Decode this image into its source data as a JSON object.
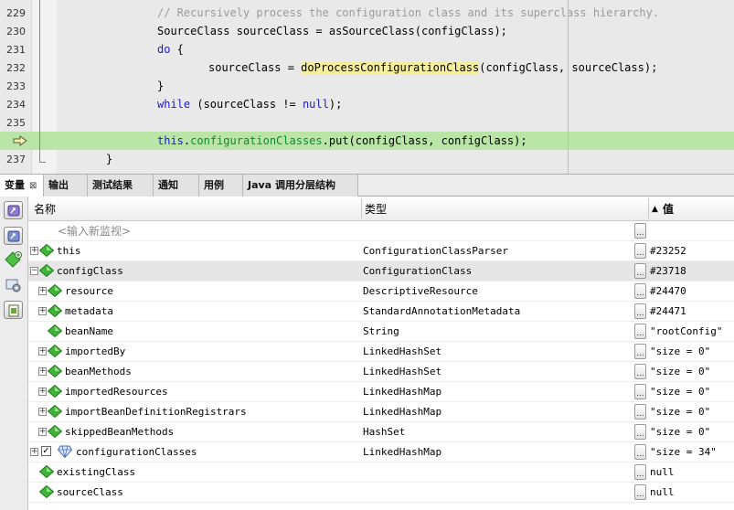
{
  "editor": {
    "lines": [
      {
        "num": "229",
        "segments": [
          {
            "t": "// Recursively process the configuration class and its superclass hierarchy.",
            "c": "cm"
          }
        ]
      },
      {
        "num": "230",
        "segments": [
          {
            "t": "SourceClass sourceClass = asSourceClass(configClass);",
            "c": ""
          }
        ]
      },
      {
        "num": "231",
        "segments": [
          {
            "t": "do",
            "c": "kw"
          },
          {
            "t": " {",
            "c": ""
          }
        ]
      },
      {
        "num": "232",
        "segments": [
          {
            "t": "sourceClass = ",
            "c": ""
          },
          {
            "t": "doProcessConfigurationClass",
            "c": "hl"
          },
          {
            "t": "(configClass, sourceClass);",
            "c": ""
          }
        ]
      },
      {
        "num": "233",
        "segments": [
          {
            "t": "}",
            "c": ""
          }
        ]
      },
      {
        "num": "234",
        "segments": [
          {
            "t": "while",
            "c": "kw"
          },
          {
            "t": " (sourceClass != ",
            "c": ""
          },
          {
            "t": "null",
            "c": "kw"
          },
          {
            "t": ");",
            "c": ""
          }
        ]
      },
      {
        "num": "235",
        "segments": []
      },
      {
        "num": "236",
        "current": true,
        "segments": [
          {
            "t": "this",
            "c": "kw"
          },
          {
            "t": ".",
            "c": ""
          },
          {
            "t": "configurationClasses",
            "c": "fld"
          },
          {
            "t": ".put(configClass, configClass);",
            "c": ""
          }
        ]
      },
      {
        "num": "237",
        "segments": [
          {
            "t": "}",
            "c": ""
          }
        ]
      }
    ]
  },
  "tabs": [
    {
      "label": "变量",
      "close": "⊠",
      "active": true
    },
    {
      "label": "输出"
    },
    {
      "label": "测试结果"
    },
    {
      "label": "通知"
    },
    {
      "label": "用例"
    },
    {
      "label": "Java 调用分层结构"
    }
  ],
  "toolbar_icons": [
    "watch-icon",
    "watch-add-icon",
    "new-watch-icon",
    "settings-icon",
    "clipboard-icon"
  ],
  "vars": {
    "columns": {
      "name": "名称",
      "type": "类型",
      "value": "值",
      "sort_glyph": "▲"
    },
    "value_button": "...",
    "placeholder": "<输入新监视>",
    "rows": [
      {
        "name": "this",
        "type": "ConfigurationClassParser",
        "value": "#23252",
        "expander": "+",
        "icon": "field-icon"
      },
      {
        "name": "configClass",
        "type": "ConfigurationClass",
        "value": "#23718",
        "expander": "−",
        "icon": "field-icon",
        "selected": true
      },
      {
        "name": "resource",
        "type": "DescriptiveResource",
        "value": "#24470",
        "expander": "+",
        "icon": "field-icon",
        "depth": 1
      },
      {
        "name": "metadata",
        "type": "StandardAnnotationMetadata",
        "value": "#24471",
        "expander": "+",
        "icon": "field-icon",
        "depth": 1
      },
      {
        "name": "beanName",
        "type": "String",
        "value": "\"rootConfig\"",
        "icon": "field-icon",
        "depth": 1
      },
      {
        "name": "importedBy",
        "type": "LinkedHashSet",
        "value": "\"size = 0\"",
        "expander": "+",
        "icon": "field-icon",
        "depth": 1
      },
      {
        "name": "beanMethods",
        "type": "LinkedHashSet",
        "value": "\"size = 0\"",
        "expander": "+",
        "icon": "field-icon",
        "depth": 1
      },
      {
        "name": "importedResources",
        "type": "LinkedHashMap",
        "value": "\"size = 0\"",
        "expander": "+",
        "icon": "field-icon",
        "depth": 1
      },
      {
        "name": "importBeanDefinitionRegistrars",
        "type": "LinkedHashMap",
        "value": "\"size = 0\"",
        "expander": "+",
        "icon": "field-icon",
        "depth": 1
      },
      {
        "name": "skippedBeanMethods",
        "type": "HashSet",
        "value": "\"size = 0\"",
        "expander": "+",
        "icon": "field-icon",
        "depth": 1
      },
      {
        "name": "configurationClasses",
        "type": "LinkedHashMap",
        "value": "\"size = 34\"",
        "expander": "+",
        "icon": "watch-diamond-icon",
        "checkbox": "✓"
      },
      {
        "name": "existingClass",
        "type": "",
        "value": "null",
        "icon": "field-icon"
      },
      {
        "name": "sourceClass",
        "type": "",
        "value": "null",
        "icon": "field-icon"
      }
    ]
  },
  "colors": {
    "current_line": "#b9e6a6",
    "highlight": "#f5ee9c",
    "keyword": "#1a1ad0",
    "comment": "#9a9a9a",
    "field": "#0a8a3a",
    "gem": "#3fb338"
  }
}
